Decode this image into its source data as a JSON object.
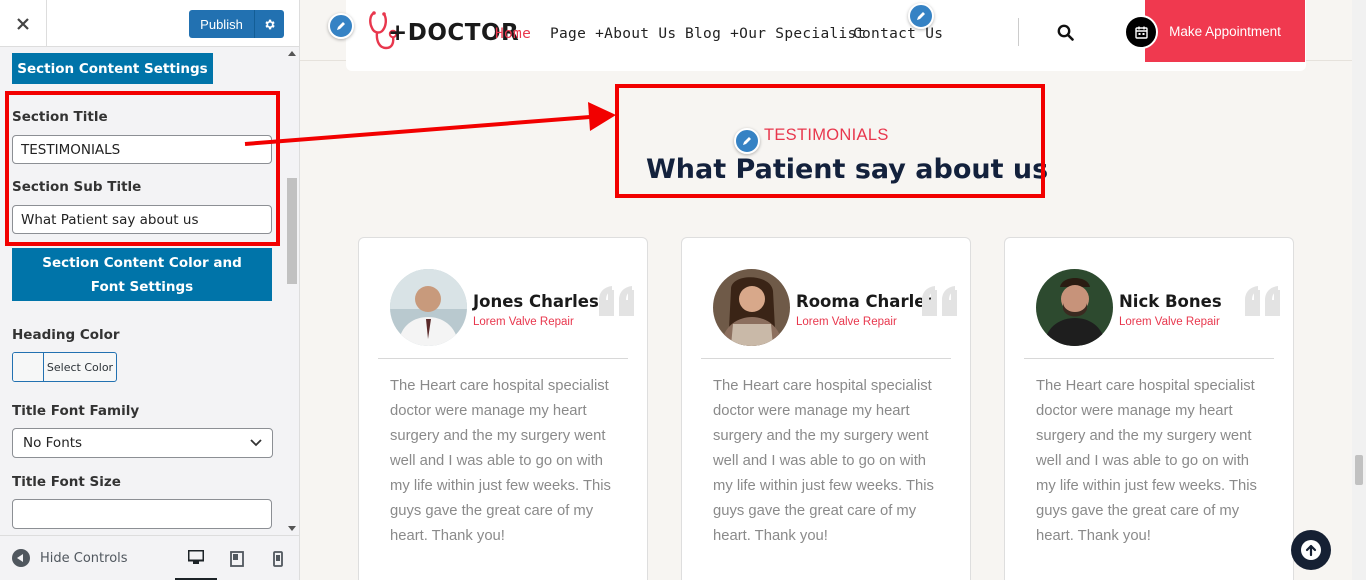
{
  "sidebar": {
    "close_icon": "close-icon",
    "publish_label": "Publish",
    "section_content_settings": "Section Content Settings",
    "section_title_label": "Section Title",
    "section_title_value": "TESTIMONIALS",
    "section_subtitle_label": "Section Sub Title",
    "section_subtitle_value": "What Patient say about us",
    "color_font_settings": "Section Content Color and Font Settings",
    "heading_color_label": "Heading Color",
    "select_color_label": "Select Color",
    "title_font_family_label": "Title Font Family",
    "title_font_family_value": "No Fonts",
    "title_font_size_label": "Title Font Size",
    "title_font_size_value": "",
    "hide_controls_label": "Hide Controls"
  },
  "header": {
    "logo_text": "+DOCTOR",
    "nav": [
      {
        "label": "Home"
      },
      {
        "label": "Page +About Us"
      },
      {
        "label": "Blog +Our Specialist"
      },
      {
        "label": "Contact Us"
      }
    ],
    "appointment_label": "Make Appointment"
  },
  "section": {
    "title": "TESTIMONIALS",
    "subtitle": "What Patient say about us"
  },
  "testimonials": [
    {
      "name": "Jones Charles",
      "role": "Lorem Valve Repair",
      "text": "The Heart care hospital specialist doctor were manage my heart surgery and the my surgery went well and I was able to go on with my life within just few weeks. This guys gave the great care of my heart. Thank you!"
    },
    {
      "name": "Rooma Charles",
      "role": "Lorem Valve Repair",
      "text": "The Heart care hospital specialist doctor were manage my heart surgery and the my surgery went well and I was able to go on with my life within just few weeks. This guys gave the great care of my heart. Thank you!"
    },
    {
      "name": "Nick Bones",
      "role": "Lorem Valve Repair",
      "text": "The Heart care hospital specialist doctor were manage my heart surgery and the my surgery went well and I was able to go on with my life within just few weeks. This guys gave the great care of my heart. Thank you!"
    }
  ],
  "colors": {
    "accent": "#e8374d",
    "wp_blue": "#0074a9",
    "annotation_red": "#f20000",
    "heading_navy": "#13213c"
  }
}
